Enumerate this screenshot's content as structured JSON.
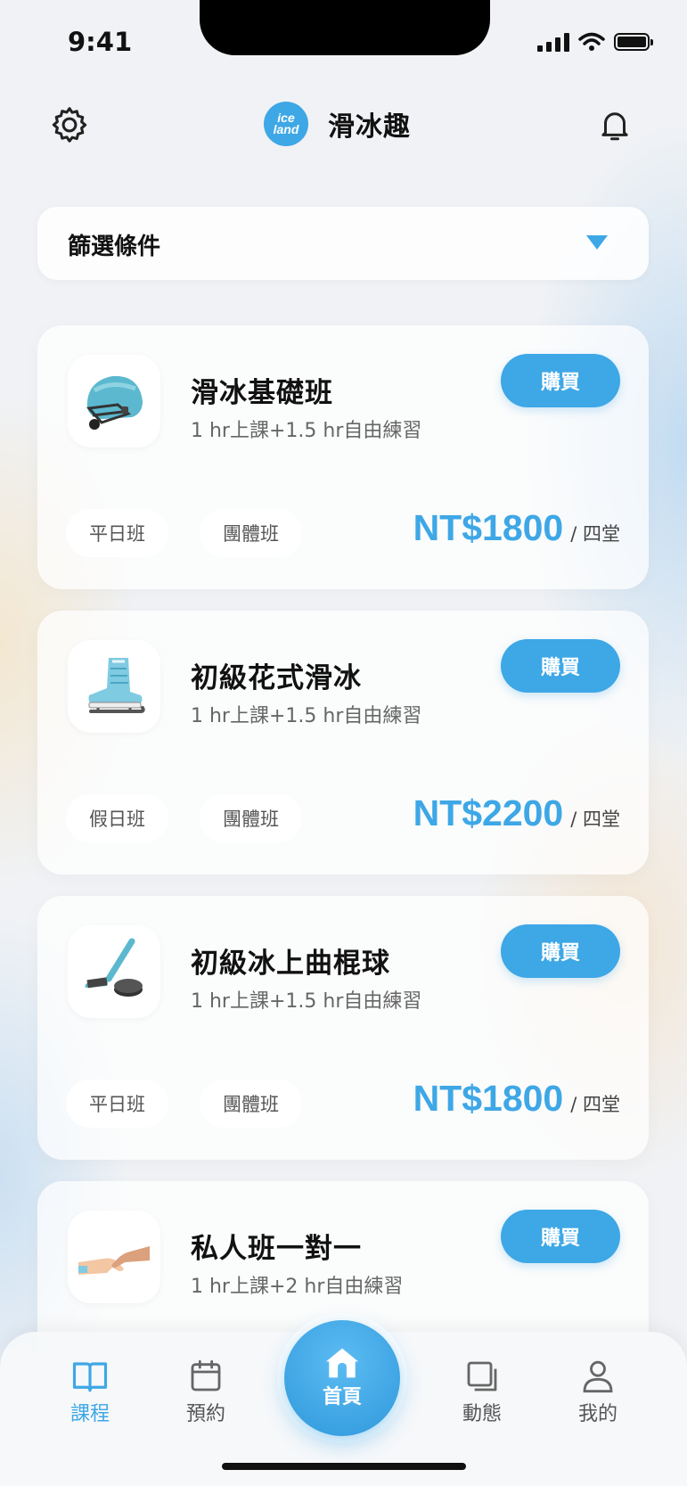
{
  "status_bar": {
    "time": "9:41"
  },
  "header": {
    "title": "滑冰趣",
    "logo_text": "ice land",
    "settings_icon": "gear-icon",
    "notification_icon": "bell-icon"
  },
  "filter": {
    "label": "篩選條件"
  },
  "courses": [
    {
      "name": "滑冰基礎班",
      "desc": "1 hr上課+1.5 hr自由練習",
      "buy": "購買",
      "tags": [
        "平日班",
        "團體班"
      ],
      "price": "NT$1800",
      "unit": "/ 四堂",
      "icon": "hockey-helmet-icon"
    },
    {
      "name": "初級花式滑冰",
      "desc": "1 hr上課+1.5 hr自由練習",
      "buy": "購買",
      "tags": [
        "假日班",
        "團體班"
      ],
      "price": "NT$2200",
      "unit": "/ 四堂",
      "icon": "figure-skate-icon"
    },
    {
      "name": "初級冰上曲棍球",
      "desc": "1 hr上課+1.5 hr自由練習",
      "buy": "購買",
      "tags": [
        "平日班",
        "團體班"
      ],
      "price": "NT$1800",
      "unit": "/ 四堂",
      "icon": "hockey-stick-icon"
    },
    {
      "name": "私人班一對一",
      "desc": "1 hr上課+2 hr自由練習",
      "buy": "購買",
      "icon": "handshake-icon"
    }
  ],
  "nav": {
    "courses": "課程",
    "booking": "預約",
    "home": "首頁",
    "feed": "動態",
    "me": "我的"
  },
  "colors": {
    "accent": "#3ea7e6",
    "text": "#111111"
  }
}
